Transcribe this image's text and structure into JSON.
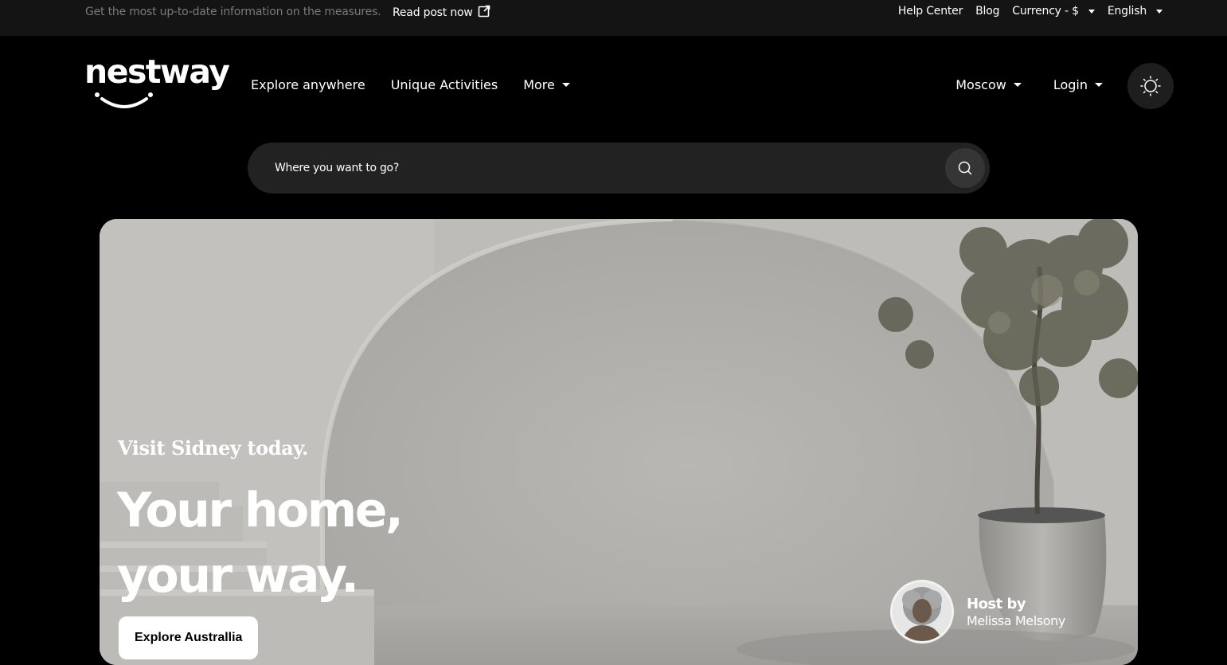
{
  "topbar": {
    "notice": "Get the most up-to-date information on the measures.",
    "read_post": "Read post now",
    "help_center": "Help Center",
    "blog": "Blog",
    "currency": "Currency - $",
    "language": "English"
  },
  "header": {
    "logo": "nestway",
    "nav": {
      "explore": "Explore anywhere",
      "activities": "Unique Activities",
      "more": "More"
    },
    "city": "Moscow",
    "login": "Login"
  },
  "search": {
    "placeholder": "Where you want to go?"
  },
  "hero": {
    "kicker": "Visit Sidney today.",
    "headline_line1": "Your home,",
    "headline_line2": "your way.",
    "cta": "Explore Australlia",
    "host_label": "Host by",
    "host_name": "Melissa Melsony"
  },
  "icons": {
    "external": "external-link-icon",
    "search": "search-icon",
    "theme": "sun-icon"
  }
}
